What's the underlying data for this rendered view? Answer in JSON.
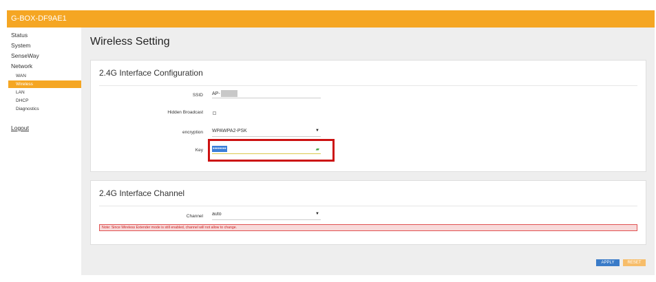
{
  "header": {
    "title": "G-BOX-DF9AE1"
  },
  "sidebar": {
    "items": [
      {
        "label": "Status"
      },
      {
        "label": "System"
      },
      {
        "label": "SenseWay"
      },
      {
        "label": "Network"
      }
    ],
    "network_sub": [
      {
        "label": "WAN"
      },
      {
        "label": "Wireless",
        "active": true
      },
      {
        "label": "LAN"
      },
      {
        "label": "DHCP"
      },
      {
        "label": "Diagnostics"
      }
    ],
    "logout": "Logout"
  },
  "page": {
    "title": "Wireless Setting"
  },
  "interface_config": {
    "title": "2.4G Interface Configuration",
    "ssid_label": "SSID",
    "ssid_value": "AP-",
    "hidden_label": "Hidden Broadcast",
    "hidden_checked": false,
    "encryption_label": "encryption",
    "encryption_value": "WPAWPA2-PSK",
    "key_label": "Key",
    "key_value": "••••••••"
  },
  "interface_channel": {
    "title": "2.4G Interface Channel",
    "channel_label": "Channel",
    "channel_value": "auto",
    "note": "Note: Since Wireless Extender mode is still enabled, channel will not allow to change."
  },
  "actions": {
    "apply": "APPLY",
    "reset": "RESET"
  },
  "icons": {
    "dropdown": "chevron-down-icon",
    "key_toggle": "eye-icon"
  },
  "colors": {
    "brand": "#f5a623",
    "apply": "#3a7bc8",
    "reset": "#f7bd6a",
    "highlight": "#cc1111",
    "note_text": "#cc2222"
  }
}
